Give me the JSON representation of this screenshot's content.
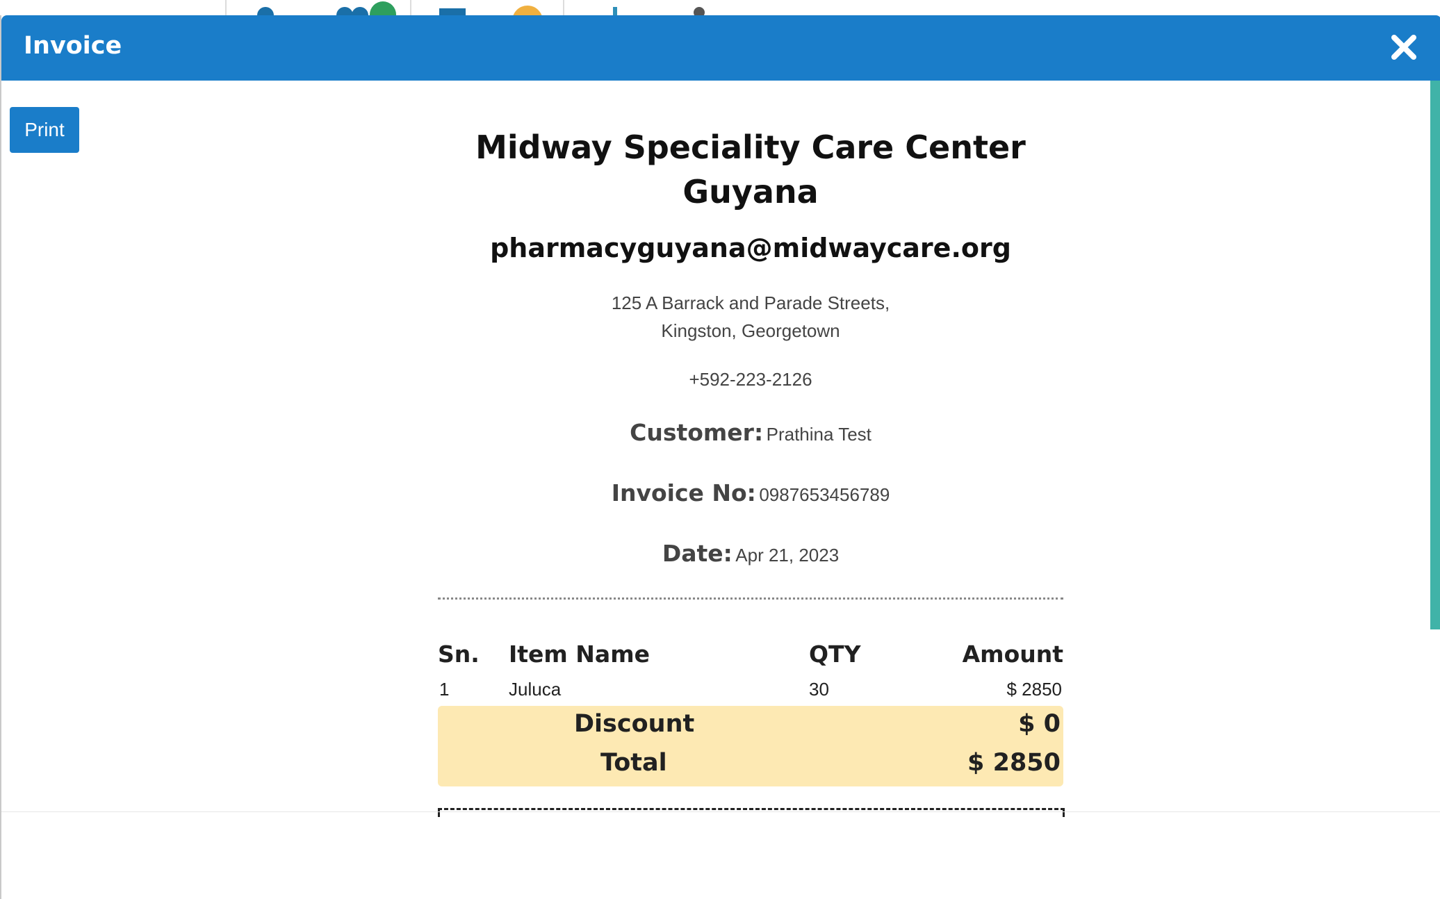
{
  "modal": {
    "title": "Invoice",
    "print_label": "Print"
  },
  "invoice": {
    "center_name_line1": "Midway Speciality Care Center",
    "center_name_line2": "Guyana",
    "email": "pharmacyguyana@midwaycare.org",
    "address_line1": "125 A Barrack and Parade Streets,",
    "address_line2": "Kingston, Georgetown",
    "phone": "+592-223-2126",
    "customer_label": "Customer:",
    "customer_value": "Prathina Test",
    "invoice_no_label": "Invoice No:",
    "invoice_no_value": "0987653456789",
    "date_label": "Date:",
    "date_value": "Apr 21, 2023"
  },
  "table": {
    "headers": [
      "Sn.",
      "Item Name",
      "QTY",
      "Amount"
    ],
    "rows": [
      {
        "sn": "1",
        "item": "Juluca",
        "qty": "30",
        "amount": "$ 2850"
      }
    ]
  },
  "totals": {
    "discount_label": "Discount",
    "discount_value": "$ 0",
    "total_label": "Total",
    "total_value": "$ 2850"
  },
  "colors": {
    "header": "#1a7dc9",
    "totals_bg": "#fde9b3",
    "scrollbar": "#40b3a8"
  },
  "icons": [
    "close-icon"
  ]
}
